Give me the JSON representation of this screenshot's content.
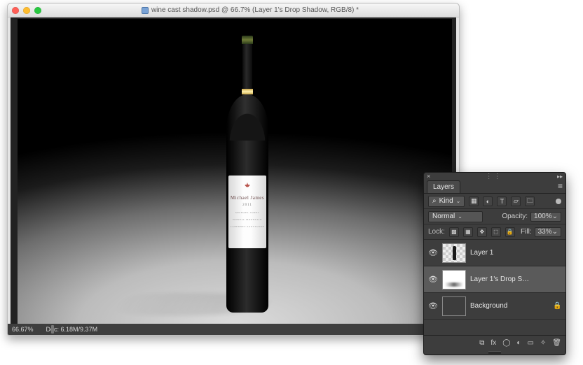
{
  "window": {
    "filename": "wine cast shadow.psd",
    "zoom_title": "66.7%",
    "layer_context": "Layer 1's Drop Shadow",
    "color_mode": "RGB/8",
    "title_composed": "wine cast shadow.psd @ 66.7% (Layer 1's Drop Shadow, RGB/8) *"
  },
  "statusbar": {
    "zoom": "66.67%",
    "doc_info": "Doc: 6.18M/9.37M"
  },
  "label": {
    "signature": "Michael James",
    "year": "2011",
    "line1": "MICHAEL JAMES",
    "line2": "HOWELL MOUNTAIN",
    "line3": "CABERNET SAUVIGNON"
  },
  "panel": {
    "tab": "Layers",
    "filter_kind_label": "Kind",
    "blend_mode": "Normal",
    "opacity_label": "Opacity:",
    "opacity_value": "100%",
    "lock_label": "Lock:",
    "fill_label": "Fill:",
    "fill_value": "33%",
    "icons": {
      "search": "⌕",
      "image": "▦",
      "adjust": "◐",
      "type": "T",
      "shape": "▱",
      "smart": "🗀",
      "dot": "●",
      "pixels": "▩",
      "position": "✥",
      "artboard": "⬚",
      "all": "🔒"
    },
    "layers": [
      {
        "name": "Layer 1",
        "visible": true,
        "locked": false,
        "thumb": "bottle"
      },
      {
        "name": "Layer 1's Drop S…",
        "visible": true,
        "locked": false,
        "thumb": "shadow",
        "selected": true
      },
      {
        "name": "Background",
        "visible": true,
        "locked": true,
        "thumb": "bg"
      }
    ],
    "footer_icons": {
      "link": "⧉",
      "fx": "fx",
      "mask": "◯",
      "adjust": "◐",
      "group": "▭",
      "new": "✧",
      "trash": "🗑"
    }
  }
}
